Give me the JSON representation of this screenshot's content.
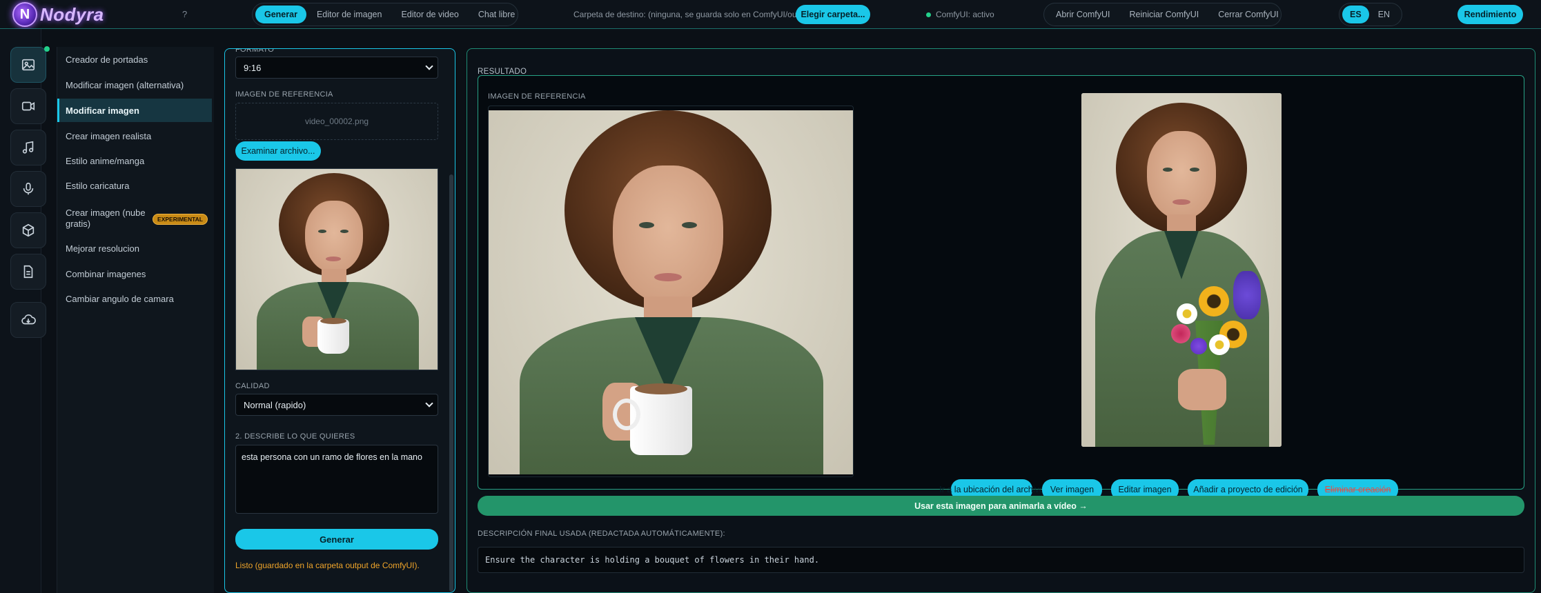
{
  "app": {
    "logo_text": "Nodyra",
    "logo_letter": "N",
    "help": "?"
  },
  "top_tabs": [
    {
      "label": "Generar"
    },
    {
      "label": "Editor de imagen"
    },
    {
      "label": "Editor de video"
    },
    {
      "label": "Chat libre"
    }
  ],
  "destination": {
    "text": "Carpeta de destino: (ninguna, se guarda solo en ComfyUI/output)",
    "button": "Elegir carpeta..."
  },
  "status": {
    "text": "ComfyUI: activo",
    "color": "#23d18b"
  },
  "comfy_actions": [
    {
      "label": "Abrir ComfyUI"
    },
    {
      "label": "Reiniciar ComfyUI"
    },
    {
      "label": "Cerrar ComfyUI"
    }
  ],
  "languages": [
    {
      "label": "ES"
    },
    {
      "label": "EN"
    }
  ],
  "performance_button": "Rendimiento",
  "rail_icons": [
    "image-icon",
    "video-icon",
    "music-icon",
    "microphone-icon",
    "cube-icon",
    "document-icon",
    "cloud-download-icon"
  ],
  "menu": {
    "items": [
      {
        "label": "Creador de portadas"
      },
      {
        "label": "Modificar imagen (alternativa)"
      },
      {
        "label": "Modificar imagen"
      },
      {
        "label": "Crear imagen realista"
      },
      {
        "label": "Estilo anime/manga"
      },
      {
        "label": "Estilo caricatura"
      },
      {
        "label": "Crear imagen (nube gratis)",
        "badge": "EXPERIMENTAL"
      },
      {
        "label": "Mejorar resolucion"
      },
      {
        "label": "Combinar imagenes"
      },
      {
        "label": "Cambiar angulo de camara"
      }
    ]
  },
  "controls": {
    "format_label": "FORMATO",
    "format_value": "9:16",
    "reference_label": "IMAGEN DE REFERENCIA",
    "reference_file": "video_00002.png",
    "browse_button": "Examinar archivo...",
    "quality_label": "CALIDAD",
    "quality_value": "Normal (rapido)",
    "describe_label": "2. DESCRIBE LO QUE QUIERES",
    "prompt": "esta persona con un ramo de flores en la mano",
    "generate_button": "Generar",
    "status_message": "Listo (guardado en la carpeta output de ComfyUI)."
  },
  "result": {
    "title": "RESULTADO",
    "reference_label": "IMAGEN DE REFERENCIA",
    "actions": [
      {
        "label": "Ir a la ubicación del archivo"
      },
      {
        "label": "Ver imagen"
      },
      {
        "label": "Editar imagen"
      },
      {
        "label": "Añadir a proyecto de edición"
      },
      {
        "label": "Eliminar creación"
      }
    ],
    "animate_button": "Usar esta imagen para animarla a vídeo →",
    "final_desc_label": "DESCRIPCIÓN FINAL USADA (REDACTADA AUTOMÁTICAMENTE):",
    "final_desc": "Ensure the character is holding a bouquet of flowers in their hand."
  },
  "colors": {
    "accent": "#1ac7e8",
    "green": "#23956a",
    "warning": "#f0a52a",
    "delete": "#e0524a"
  }
}
